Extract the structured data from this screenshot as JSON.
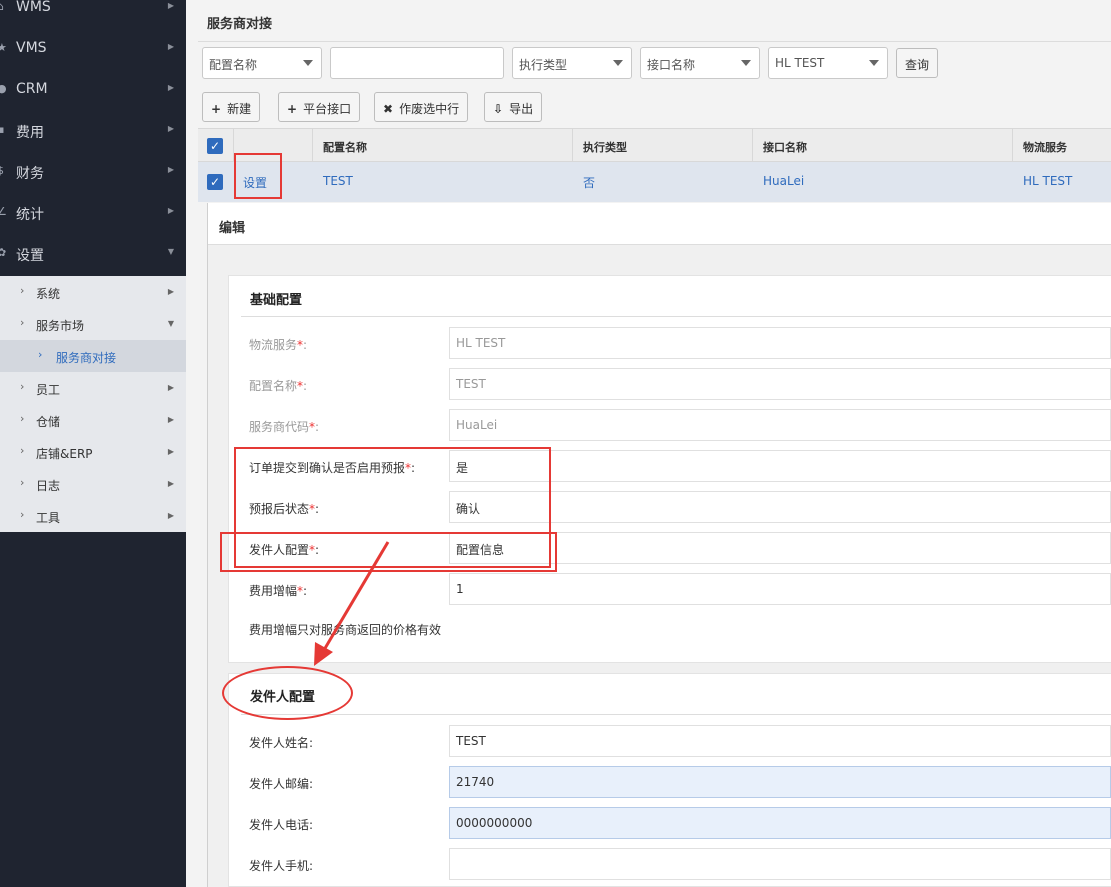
{
  "sidebar": {
    "top_items": [
      {
        "icon": "bank-icon",
        "glyph": "⌂",
        "label": "WMS"
      },
      {
        "icon": "star-icon",
        "glyph": "★",
        "label": "VMS"
      },
      {
        "icon": "user-icon",
        "glyph": "●",
        "label": "CRM"
      },
      {
        "icon": "money-icon",
        "glyph": "▪",
        "label": "费用"
      },
      {
        "icon": "dollar-icon",
        "glyph": "$",
        "label": "财务"
      },
      {
        "icon": "chart-icon",
        "glyph": "∠",
        "label": "统计"
      },
      {
        "icon": "gear-icon",
        "glyph": "✿",
        "label": "设置"
      }
    ],
    "sub_items": [
      {
        "label": "系统"
      },
      {
        "label": "服务市场"
      },
      {
        "label": "服务商对接",
        "active": true
      },
      {
        "label": "员工"
      },
      {
        "label": "仓储"
      },
      {
        "label": "店铺&ERP"
      },
      {
        "label": "日志"
      },
      {
        "label": "工具"
      }
    ]
  },
  "page": {
    "title": "服务商对接"
  },
  "filters": {
    "config_name": "配置名称",
    "exec_type": "执行类型",
    "interface_name": "接口名称",
    "logistics": "HL TEST",
    "query_button": "查询"
  },
  "toolbar": {
    "new_icon": "+",
    "new_label": "新建",
    "platform_icon": "+",
    "platform_label": "平台接口",
    "void_icon": "✖",
    "void_label": "作废选中行",
    "export_icon": "⇩",
    "export_label": "导出"
  },
  "table": {
    "columns": [
      "配置名称",
      "执行类型",
      "接口名称",
      "物流服务"
    ],
    "rows": [
      {
        "action": "设置",
        "config_name": "TEST",
        "exec_type": "否",
        "interface_name": "HuaLei",
        "logistics": "HL TEST"
      }
    ]
  },
  "dialog": {
    "title": "编辑",
    "basic": {
      "title": "基础配置",
      "fields": [
        {
          "label": "物流服务",
          "value": "HL TEST"
        },
        {
          "label": "配置名称",
          "value": "TEST"
        },
        {
          "label": "服务商代码",
          "value": "HuaLei"
        },
        {
          "label": "订单提交到确认是否启用预报",
          "value": "是"
        },
        {
          "label": "预报后状态",
          "value": "确认"
        },
        {
          "label": "发件人配置",
          "value": "配置信息"
        },
        {
          "label": "费用增幅",
          "value": "1"
        }
      ],
      "note": "费用增幅只对服务商返回的价格有效"
    },
    "sender": {
      "title": "发件人配置",
      "fields": [
        {
          "label": "发件人姓名:",
          "value": "TEST"
        },
        {
          "label": "发件人邮编:",
          "value": "21740"
        },
        {
          "label": "发件人电话:",
          "value": "0000000000"
        },
        {
          "label": "发件人手机:",
          "value": ""
        }
      ]
    }
  },
  "colors": {
    "accent": "#2f6bbd",
    "annotation": "#e53935",
    "sidebar": "#1f2430"
  }
}
